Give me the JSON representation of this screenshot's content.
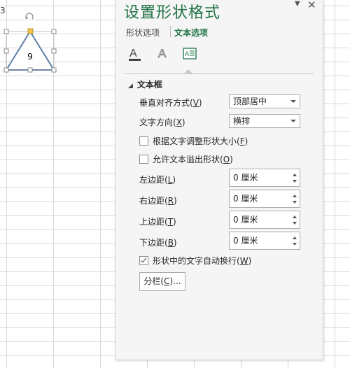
{
  "sheet": {
    "cell_label": "3",
    "shape_text": "9"
  },
  "pane": {
    "title": "设置形状格式",
    "menu_icon": "dropdown-arrow-icon",
    "close_icon": "close-icon",
    "tabs": [
      {
        "label": "形状选项",
        "active": false
      },
      {
        "label": "文本选项",
        "active": true
      }
    ],
    "sub_icons": [
      "text-fill-icon",
      "text-outline-icon",
      "textbox-icon"
    ],
    "section": {
      "title": "文本框",
      "expanded": true
    },
    "vertical_align": {
      "label_pre": "垂直对齐方式(",
      "key": "V",
      "label_post": ")",
      "value": "顶部居中"
    },
    "text_direction": {
      "label_pre": "文字方向(",
      "key": "X",
      "label_post": ")",
      "value": "横排"
    },
    "resize_shape": {
      "label_pre": "根据文字调整形状大小(",
      "key": "F",
      "label_post": ")",
      "checked": false
    },
    "allow_overflow": {
      "label_pre": "允许文本溢出形状(",
      "key": "O",
      "label_post": ")",
      "checked": false
    },
    "left_margin": {
      "label_pre": "左边距(",
      "key": "L",
      "label_post": ")",
      "value": "0 厘米"
    },
    "right_margin": {
      "label_pre": "右边距(",
      "key": "R",
      "label_post": ")",
      "value": "0 厘米"
    },
    "top_margin": {
      "label_pre": "上边距(",
      "key": "T",
      "label_post": ")",
      "value": "0 厘米"
    },
    "bottom_margin": {
      "label_pre": "下边距(",
      "key": "B",
      "label_post": ")",
      "value": "0 厘米"
    },
    "wrap_text": {
      "label_pre": "形状中的文字自动换行(",
      "key": "W",
      "label_post": ")",
      "checked": true
    },
    "columns_button": {
      "label_pre": "分栏(",
      "key": "C",
      "label_post": ")..."
    }
  },
  "colors": {
    "accent": "#217346",
    "shape_fill": "#ffffff",
    "shape_stroke": "#5b7fa6",
    "handle_yellow": "#f3c44a"
  }
}
